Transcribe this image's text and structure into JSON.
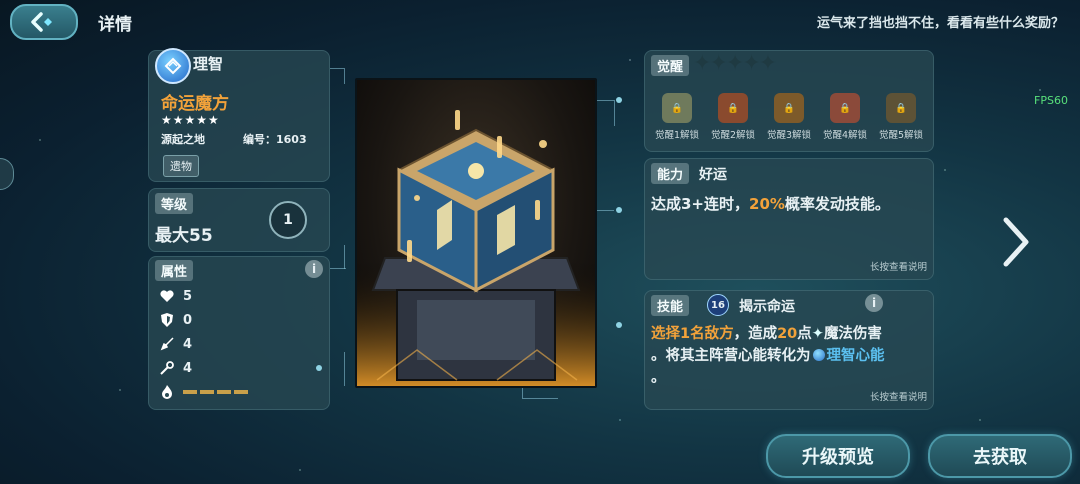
{
  "header": {
    "title": "详情",
    "tagline": "运气来了挡也挡不住，看看有些什么奖励？",
    "fps": "FPS60"
  },
  "item": {
    "faction": "理智",
    "name": "命运魔方",
    "stars": "★★★★★",
    "origin": "源起之地",
    "number_label": "编号：1603",
    "type_tag": "遗物"
  },
  "level": {
    "tag": "等级",
    "value": "最大55",
    "badge": "1"
  },
  "attributes": {
    "tag": "属性",
    "rows": [
      {
        "icon": "heart-icon",
        "value": "5"
      },
      {
        "icon": "shield-icon",
        "value": "0"
      },
      {
        "icon": "sword-icon",
        "value": "4"
      },
      {
        "icon": "wand-icon",
        "value": "4"
      },
      {
        "icon": "flame-icon",
        "value": ""
      }
    ]
  },
  "awaken": {
    "tag": "觉醒",
    "locks": [
      {
        "label": "觉醒1解锁",
        "color": "#6f7a5c"
      },
      {
        "label": "觉醒2解锁",
        "color": "#8a4a2e"
      },
      {
        "label": "觉醒3解锁",
        "color": "#7d5a2a"
      },
      {
        "label": "觉醒4解锁",
        "color": "#8b4a3a"
      },
      {
        "label": "觉醒5解锁",
        "color": "#5d5236"
      }
    ]
  },
  "ability": {
    "tag": "能力",
    "name": "好运",
    "desc_pre": "达成3+连时，",
    "desc_highlight": "20%",
    "desc_post": "概率发动技能。",
    "hint": "长按查看说明"
  },
  "skill": {
    "tag": "技能",
    "level": "16",
    "name": "揭示命运",
    "line1_hl": "选择1名敌方",
    "line1_mid": "，造成",
    "line1_num": "20",
    "line1_post": "点",
    "line1_end": "魔法伤害",
    "line2": "。将其主阵营心能转化为",
    "line2_hl": "理智心能",
    "line3": "。",
    "hint": "长按查看说明"
  },
  "buttons": {
    "upgrade": "升级预览",
    "obtain": "去获取"
  },
  "colors": {
    "accent": "#f2a23a",
    "skill_blue": "#5bc0f0"
  }
}
